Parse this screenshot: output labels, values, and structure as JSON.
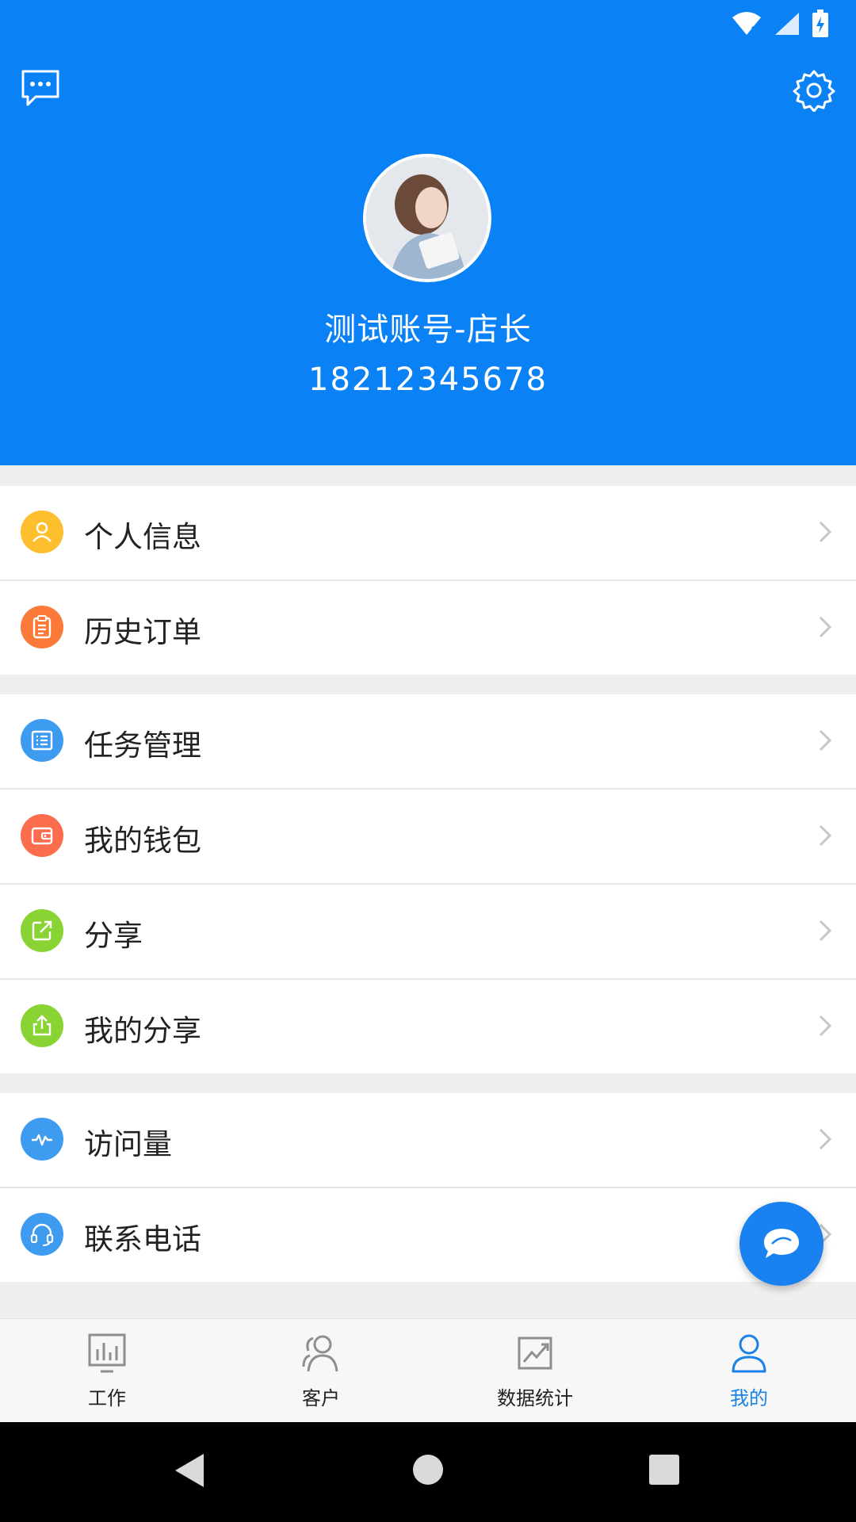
{
  "colors": {
    "header_bg": "#0a82f5",
    "accent": "#1a82e6"
  },
  "profile": {
    "name": "测试账号-店长",
    "phone": "18212345678"
  },
  "menu_groups": [
    {
      "items": [
        {
          "label": "个人信息",
          "icon": "person-icon",
          "color": "#fdbf2d"
        },
        {
          "label": "历史订单",
          "icon": "clipboard-icon",
          "color": "#fb7a3a"
        }
      ]
    },
    {
      "items": [
        {
          "label": "任务管理",
          "icon": "list-icon",
          "color": "#3d9bf0"
        },
        {
          "label": "我的钱包",
          "icon": "wallet-icon",
          "color": "#fb6d4c"
        },
        {
          "label": "分享",
          "icon": "share-icon",
          "color": "#8ad334"
        },
        {
          "label": "我的分享",
          "icon": "upload-icon",
          "color": "#8ad334"
        }
      ]
    },
    {
      "items": [
        {
          "label": "访问量",
          "icon": "pulse-icon",
          "color": "#3d9bf0"
        },
        {
          "label": "联系电话",
          "icon": "headset-icon",
          "color": "#3d9bf0"
        }
      ]
    }
  ],
  "tabs": [
    {
      "label": "工作",
      "icon": "bar-chart-icon",
      "active": false
    },
    {
      "label": "客户",
      "icon": "customers-icon",
      "active": false
    },
    {
      "label": "数据统计",
      "icon": "trend-chart-icon",
      "active": false
    },
    {
      "label": "我的",
      "icon": "user-icon",
      "active": true
    }
  ]
}
